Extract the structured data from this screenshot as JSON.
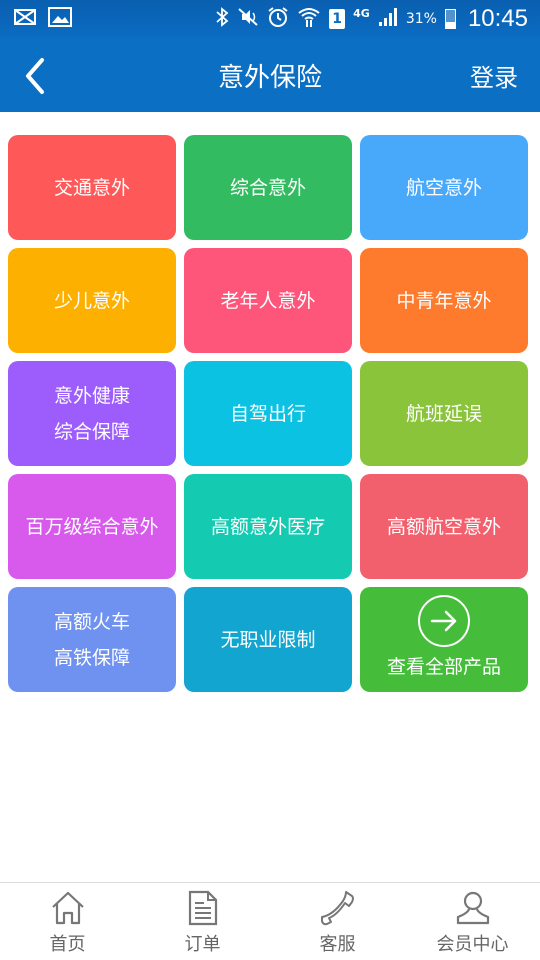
{
  "statusbar": {
    "network": "4G",
    "sim": "1",
    "battery_percent": "31%",
    "time": "10:45"
  },
  "header": {
    "title": "意外保险",
    "login_label": "登录"
  },
  "tiles": [
    {
      "lines": [
        "交通意外"
      ],
      "color": "#fe5958"
    },
    {
      "lines": [
        "综合意外"
      ],
      "color": "#33bb62"
    },
    {
      "lines": [
        "航空意外"
      ],
      "color": "#48a9fb"
    },
    {
      "lines": [
        "少儿意外"
      ],
      "color": "#feb000"
    },
    {
      "lines": [
        "老年人意外"
      ],
      "color": "#fe557b"
    },
    {
      "lines": [
        "中青年意外"
      ],
      "color": "#fe7a2c"
    },
    {
      "lines": [
        "意外健康",
        "综合保障"
      ],
      "color": "#9d5cfc"
    },
    {
      "lines": [
        "自驾出行"
      ],
      "color": "#0cc2e2"
    },
    {
      "lines": [
        "航班延误"
      ],
      "color": "#8ac43b"
    },
    {
      "lines": [
        "百万级综合意外"
      ],
      "color": "#d85aec"
    },
    {
      "lines": [
        "高额意外医疗"
      ],
      "color": "#14cbb1"
    },
    {
      "lines": [
        "高额航空意外"
      ],
      "color": "#f1606c"
    },
    {
      "lines": [
        "高额火车",
        "高铁保障"
      ],
      "color": "#6f91f0"
    },
    {
      "lines": [
        "无职业限制"
      ],
      "color": "#12a5cf"
    },
    {
      "lines": [
        "查看全部产品"
      ],
      "color": "#45bd3a",
      "icon": "arrow-right-circle-icon"
    }
  ],
  "tabbar": {
    "items": [
      {
        "label": "首页",
        "icon": "home-icon"
      },
      {
        "label": "订单",
        "icon": "document-icon"
      },
      {
        "label": "客服",
        "icon": "phone-icon"
      },
      {
        "label": "会员中心",
        "icon": "user-icon"
      }
    ]
  }
}
